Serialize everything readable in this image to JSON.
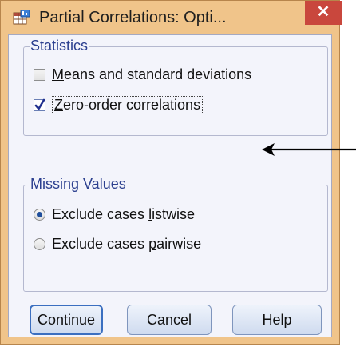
{
  "window": {
    "title": "Partial Correlations: Opti...",
    "close_label": "✕"
  },
  "statistics": {
    "group_label": "Statistics",
    "means_sd": {
      "label_first": "M",
      "label_rest": "eans and standard deviations",
      "checked": false
    },
    "zero_order": {
      "label_first": "Z",
      "label_rest": "ero-order correlations",
      "checked": true
    }
  },
  "missing_values": {
    "group_label": "Missing Values",
    "listwise": {
      "label_pre": "Exclude cases ",
      "label_u": "l",
      "label_post": "istwise",
      "selected": true
    },
    "pairwise": {
      "label_pre": "Exclude cases ",
      "label_u": "p",
      "label_post": "airwise",
      "selected": false
    }
  },
  "buttons": {
    "continue": "Continue",
    "cancel": "Cancel",
    "help": "Help"
  },
  "colors": {
    "title_bar": "#f0c48a",
    "close_button": "#c9473d",
    "client_bg": "#f3f4fb",
    "group_label": "#2b3f8f",
    "annotation_arrow": "#000000"
  },
  "icons": {
    "app": "spss-table-icon",
    "annotation": "left-arrow-icon"
  }
}
